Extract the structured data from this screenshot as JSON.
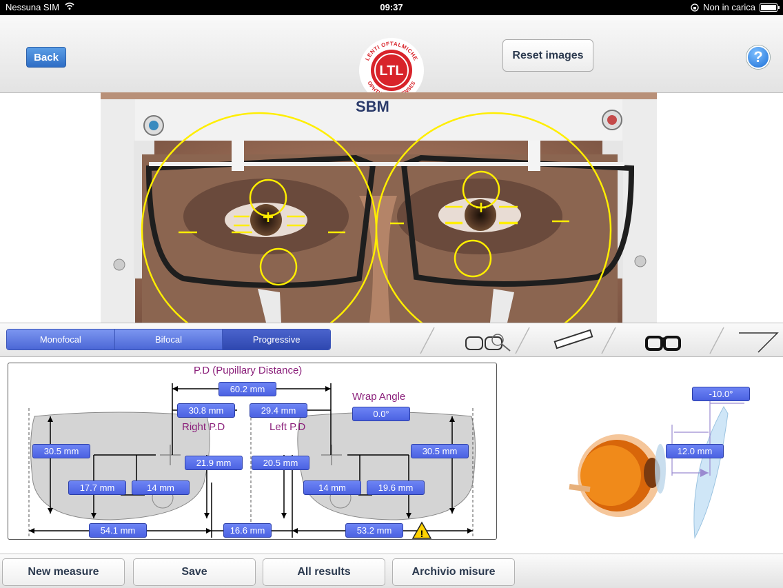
{
  "status": {
    "carrier": "Nessuna SIM",
    "time": "09:37",
    "charging": "Non in carica"
  },
  "nav": {
    "back": "Back",
    "reset": "Reset images",
    "help": "?",
    "logo_top": "LENTI OFTALMICHE",
    "logo_bottom": "OPHTHALMIC LENSES",
    "logo_mark": "LTL"
  },
  "photo": {
    "brand": "SBM"
  },
  "lens_types": [
    "Monofocal",
    "Bifocal",
    "Progressive"
  ],
  "lens_types_selected": "Progressive",
  "measures": {
    "pd_title": "P.D (Pupillary Distance)",
    "pd_total": "60.2 mm",
    "right_pd": "30.8 mm",
    "left_pd": "29.4 mm",
    "right_pd_label": "Right P.D",
    "left_pd_label": "Left P.D",
    "wrap_title": "Wrap Angle",
    "wrap_value": "0.0°",
    "right_height": "30.5 mm",
    "left_height": "30.5 mm",
    "right_half": "21.9 mm",
    "left_half": "20.5 mm",
    "right_seg": "17.7 mm",
    "right_near": "14 mm",
    "left_near": "14 mm",
    "left_seg": "19.6 mm",
    "right_width": "54.1 mm",
    "bridge": "16.6 mm",
    "left_width": "53.2 mm",
    "warning": "!"
  },
  "side": {
    "tilt": "-10.0°",
    "vertex": "12.0 mm"
  },
  "bottom": {
    "new": "New measure",
    "save": "Save",
    "all": "All results",
    "archive": "Archivio misure"
  }
}
